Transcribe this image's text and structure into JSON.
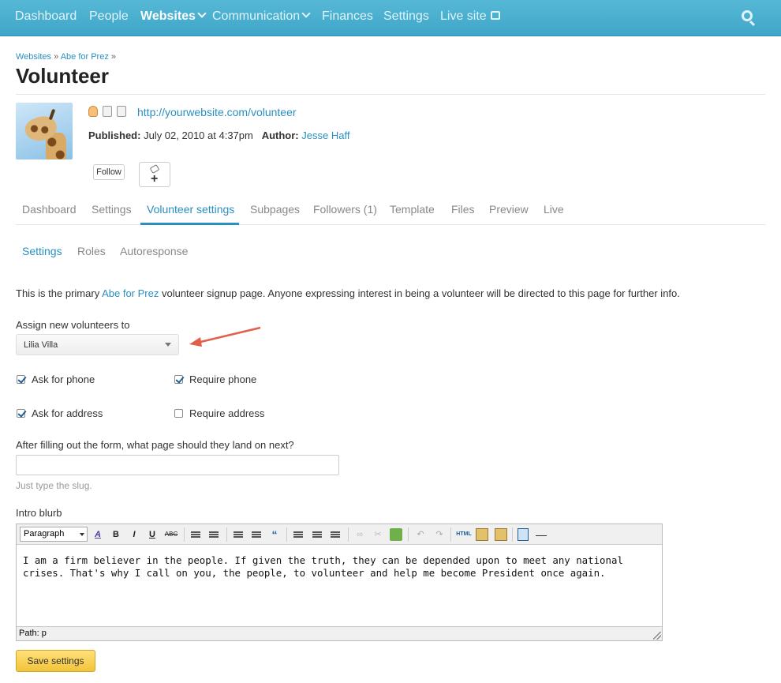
{
  "topnav": {
    "items": [
      "Dashboard",
      "People",
      "Websites",
      "Communication",
      "Finances",
      "Settings",
      "Live site"
    ]
  },
  "breadcrumb": {
    "level1": "Websites",
    "sep": "»",
    "level2": "Abe for Prez"
  },
  "page": {
    "title": "Volunteer"
  },
  "meta": {
    "url": "http://yourwebsite.com/volunteer",
    "published_label": "Published:",
    "published_value": "July 02, 2010 at 4:37pm",
    "author_label": "Author:",
    "author_value": "Jesse Haff"
  },
  "actions": {
    "follow": "Follow",
    "tag_plus": "+"
  },
  "tabs": [
    "Dashboard",
    "Settings",
    "Volunteer settings",
    "Subpages",
    "Followers (1)",
    "Template",
    "Files",
    "Preview",
    "Live"
  ],
  "subtabs": [
    "Settings",
    "Roles",
    "Autoresponse"
  ],
  "form": {
    "intro_before": "This is the primary ",
    "intro_link": "Abe for Prez",
    "intro_after": " volunteer signup page. Anyone expressing interest in being a volunteer will be directed to this page for further info.",
    "assign_label": "Assign new volunteers to",
    "assign_value": "Lilia Villa",
    "checks": {
      "ask_phone": {
        "label": "Ask for phone",
        "checked": true
      },
      "require_phone": {
        "label": "Require phone",
        "checked": true
      },
      "ask_address": {
        "label": "Ask for address",
        "checked": true
      },
      "require_address": {
        "label": "Require address",
        "checked": false
      }
    },
    "landing_label": "After filling out the form, what page should they land on next?",
    "landing_value": "",
    "landing_hint": "Just type the slug.",
    "blurb_label": "Intro blurb",
    "editor": {
      "format": "Paragraph",
      "content": "I am a firm believer in the people. If given the truth, they can be depended upon to meet any national crises. That's why I call on you, the people, to volunteer and help me become President once again.",
      "path": "Path: p",
      "buttons": {
        "bold": "B",
        "italic": "I",
        "underline": "U",
        "strike": "ABC",
        "quote": "“",
        "html": "HTML",
        "hr": "—"
      }
    },
    "save": "Save settings"
  },
  "colors": {
    "nav": "#4bb0d0",
    "link": "#2a8fc1",
    "arrow": "#e0604a",
    "save": "#f2c43a"
  }
}
